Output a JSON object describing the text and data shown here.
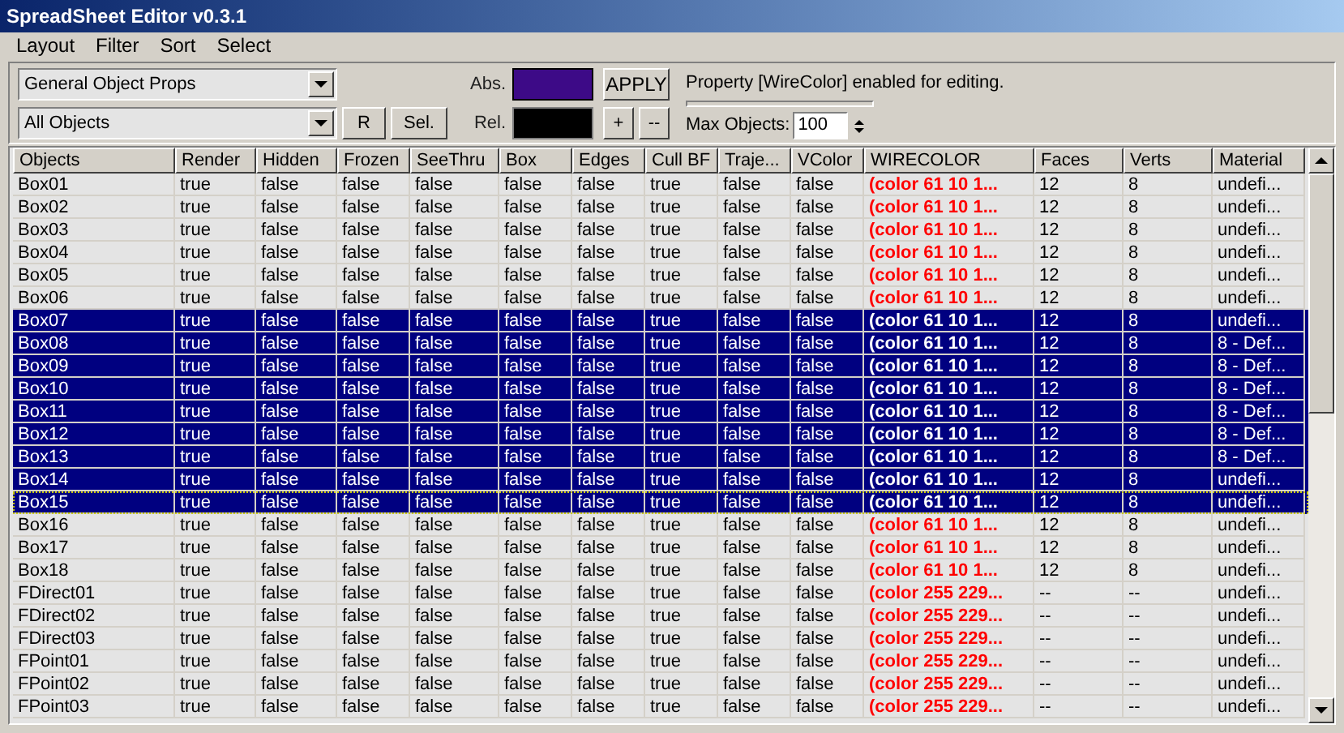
{
  "window": {
    "title": "SpreadSheet Editor v0.3.1"
  },
  "menu": [
    "Layout",
    "Filter",
    "Sort",
    "Select"
  ],
  "toolbar": {
    "property_set": "General Object Props",
    "object_filter": "All Objects",
    "buttons": [
      "R",
      "Sel."
    ],
    "abs": {
      "label": "Abs.",
      "color": "#3d0a87"
    },
    "rel": {
      "label": "Rel.",
      "color": "#000000"
    },
    "apply": "APPLY",
    "plus": "+",
    "minus": "--",
    "status": "Property [WireColor] enabled for editing.",
    "max_label": "Max Objects:",
    "max_value": "100"
  },
  "table": {
    "columns": [
      {
        "label": "Objects",
        "kind": "text"
      },
      {
        "label": "Render",
        "kind": "text"
      },
      {
        "label": "Hidden",
        "kind": "text"
      },
      {
        "label": "Frozen",
        "kind": "text"
      },
      {
        "label": "SeeThru",
        "kind": "text"
      },
      {
        "label": "Box",
        "kind": "text"
      },
      {
        "label": "Edges",
        "kind": "text"
      },
      {
        "label": "Cull BF",
        "kind": "text"
      },
      {
        "label": "Traje...",
        "kind": "text"
      },
      {
        "label": "VColor",
        "kind": "text"
      },
      {
        "label": "WIRECOLOR",
        "kind": "color"
      },
      {
        "label": "Faces",
        "kind": "text"
      },
      {
        "label": "Verts",
        "kind": "text"
      },
      {
        "label": "Material",
        "kind": "text"
      }
    ],
    "rows": [
      {
        "selected": false,
        "focused": false,
        "cells": [
          "Box01",
          "true",
          "false",
          "false",
          "false",
          "false",
          "false",
          "true",
          "false",
          "false",
          "(color 61 10 1...",
          "12",
          "8",
          "undefi..."
        ]
      },
      {
        "selected": false,
        "focused": false,
        "cells": [
          "Box02",
          "true",
          "false",
          "false",
          "false",
          "false",
          "false",
          "true",
          "false",
          "false",
          "(color 61 10 1...",
          "12",
          "8",
          "undefi..."
        ]
      },
      {
        "selected": false,
        "focused": false,
        "cells": [
          "Box03",
          "true",
          "false",
          "false",
          "false",
          "false",
          "false",
          "true",
          "false",
          "false",
          "(color 61 10 1...",
          "12",
          "8",
          "undefi..."
        ]
      },
      {
        "selected": false,
        "focused": false,
        "cells": [
          "Box04",
          "true",
          "false",
          "false",
          "false",
          "false",
          "false",
          "true",
          "false",
          "false",
          "(color 61 10 1...",
          "12",
          "8",
          "undefi..."
        ]
      },
      {
        "selected": false,
        "focused": false,
        "cells": [
          "Box05",
          "true",
          "false",
          "false",
          "false",
          "false",
          "false",
          "true",
          "false",
          "false",
          "(color 61 10 1...",
          "12",
          "8",
          "undefi..."
        ]
      },
      {
        "selected": false,
        "focused": false,
        "cells": [
          "Box06",
          "true",
          "false",
          "false",
          "false",
          "false",
          "false",
          "true",
          "false",
          "false",
          "(color 61 10 1...",
          "12",
          "8",
          "undefi..."
        ]
      },
      {
        "selected": true,
        "focused": false,
        "cells": [
          "Box07",
          "true",
          "false",
          "false",
          "false",
          "false",
          "false",
          "true",
          "false",
          "false",
          "(color 61 10 1...",
          "12",
          "8",
          "undefi..."
        ]
      },
      {
        "selected": true,
        "focused": false,
        "cells": [
          "Box08",
          "true",
          "false",
          "false",
          "false",
          "false",
          "false",
          "true",
          "false",
          "false",
          "(color 61 10 1...",
          "12",
          "8",
          "8 - Def..."
        ]
      },
      {
        "selected": true,
        "focused": false,
        "cells": [
          "Box09",
          "true",
          "false",
          "false",
          "false",
          "false",
          "false",
          "true",
          "false",
          "false",
          "(color 61 10 1...",
          "12",
          "8",
          "8 - Def..."
        ]
      },
      {
        "selected": true,
        "focused": false,
        "cells": [
          "Box10",
          "true",
          "false",
          "false",
          "false",
          "false",
          "false",
          "true",
          "false",
          "false",
          "(color 61 10 1...",
          "12",
          "8",
          "8 - Def..."
        ]
      },
      {
        "selected": true,
        "focused": false,
        "cells": [
          "Box11",
          "true",
          "false",
          "false",
          "false",
          "false",
          "false",
          "true",
          "false",
          "false",
          "(color 61 10 1...",
          "12",
          "8",
          "8 - Def..."
        ]
      },
      {
        "selected": true,
        "focused": false,
        "cells": [
          "Box12",
          "true",
          "false",
          "false",
          "false",
          "false",
          "false",
          "true",
          "false",
          "false",
          "(color 61 10 1...",
          "12",
          "8",
          "8 - Def..."
        ]
      },
      {
        "selected": true,
        "focused": false,
        "cells": [
          "Box13",
          "true",
          "false",
          "false",
          "false",
          "false",
          "false",
          "true",
          "false",
          "false",
          "(color 61 10 1...",
          "12",
          "8",
          "8 - Def..."
        ]
      },
      {
        "selected": true,
        "focused": false,
        "cells": [
          "Box14",
          "true",
          "false",
          "false",
          "false",
          "false",
          "false",
          "true",
          "false",
          "false",
          "(color 61 10 1...",
          "12",
          "8",
          "undefi..."
        ]
      },
      {
        "selected": true,
        "focused": true,
        "cells": [
          "Box15",
          "true",
          "false",
          "false",
          "false",
          "false",
          "false",
          "true",
          "false",
          "false",
          "(color 61 10 1...",
          "12",
          "8",
          "undefi..."
        ]
      },
      {
        "selected": false,
        "focused": false,
        "cells": [
          "Box16",
          "true",
          "false",
          "false",
          "false",
          "false",
          "false",
          "true",
          "false",
          "false",
          "(color 61 10 1...",
          "12",
          "8",
          "undefi..."
        ]
      },
      {
        "selected": false,
        "focused": false,
        "cells": [
          "Box17",
          "true",
          "false",
          "false",
          "false",
          "false",
          "false",
          "true",
          "false",
          "false",
          "(color 61 10 1...",
          "12",
          "8",
          "undefi..."
        ]
      },
      {
        "selected": false,
        "focused": false,
        "cells": [
          "Box18",
          "true",
          "false",
          "false",
          "false",
          "false",
          "false",
          "true",
          "false",
          "false",
          "(color 61 10 1...",
          "12",
          "8",
          "undefi..."
        ]
      },
      {
        "selected": false,
        "focused": false,
        "cells": [
          "FDirect01",
          "true",
          "false",
          "false",
          "false",
          "false",
          "false",
          "true",
          "false",
          "false",
          "(color 255 229...",
          "--",
          "--",
          "undefi..."
        ]
      },
      {
        "selected": false,
        "focused": false,
        "cells": [
          "FDirect02",
          "true",
          "false",
          "false",
          "false",
          "false",
          "false",
          "true",
          "false",
          "false",
          "(color 255 229...",
          "--",
          "--",
          "undefi..."
        ]
      },
      {
        "selected": false,
        "focused": false,
        "cells": [
          "FDirect03",
          "true",
          "false",
          "false",
          "false",
          "false",
          "false",
          "true",
          "false",
          "false",
          "(color 255 229...",
          "--",
          "--",
          "undefi..."
        ]
      },
      {
        "selected": false,
        "focused": false,
        "cells": [
          "FPoint01",
          "true",
          "false",
          "false",
          "false",
          "false",
          "false",
          "true",
          "false",
          "false",
          "(color 255 229...",
          "--",
          "--",
          "undefi..."
        ]
      },
      {
        "selected": false,
        "focused": false,
        "cells": [
          "FPoint02",
          "true",
          "false",
          "false",
          "false",
          "false",
          "false",
          "true",
          "false",
          "false",
          "(color 255 229...",
          "--",
          "--",
          "undefi..."
        ]
      },
      {
        "selected": false,
        "focused": false,
        "cells": [
          "FPoint03",
          "true",
          "false",
          "false",
          "false",
          "false",
          "false",
          "true",
          "false",
          "false",
          "(color 255 229...",
          "--",
          "--",
          "undefi..."
        ]
      }
    ]
  }
}
